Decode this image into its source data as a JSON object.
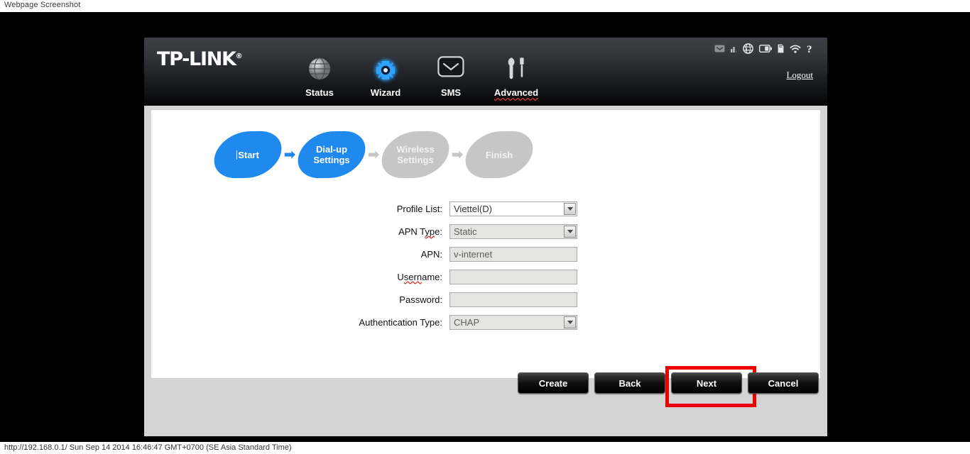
{
  "browser": {
    "top_label": "Webpage Screenshot",
    "status_footer": "http://192.168.0.1/ Sun Sep 14 2014 16:46:47 GMT+0700 (SE Asia Standard Time)"
  },
  "colors": {
    "accent_blue": "#2089ee",
    "inactive_gray": "#c6c6c6",
    "highlight_red": "#ee0000",
    "page_gray": "#d4d4d4"
  },
  "header": {
    "logo": "TP-LINK",
    "logo_mark": "®",
    "logout_label": "Logout",
    "nav": [
      {
        "label": "Status",
        "icon": "globe-icon",
        "active": false,
        "squiggly": false
      },
      {
        "label": "Wizard",
        "icon": "wizard-gear-icon",
        "active": true,
        "squiggly": false
      },
      {
        "label": "SMS",
        "icon": "envelope-icon",
        "active": false,
        "squiggly": false
      },
      {
        "label": "Advanced",
        "icon": "tools-icon",
        "active": false,
        "squiggly": true
      }
    ],
    "status_icons": [
      "message-envelope-icon",
      "signal-bars-icon",
      "globe-roaming-icon",
      "battery-icon",
      "sim-card-icon",
      "wifi-icon",
      "help-question-icon"
    ]
  },
  "wizard": {
    "steps": [
      {
        "label": "Start",
        "state": "active",
        "has_caret": true
      },
      {
        "label": "Dial-up\nSettings",
        "state": "active",
        "has_caret": false
      },
      {
        "label": "Wireless\nSettings",
        "state": "idle",
        "has_caret": false
      },
      {
        "label": "Finish",
        "state": "idle",
        "has_caret": false
      }
    ],
    "arrow_glyph": "➡"
  },
  "form": {
    "fields": [
      {
        "label": "Profile List:",
        "value": "Viettel(D)",
        "type": "select",
        "disabled": false
      },
      {
        "label": "APN Type:",
        "value": "Static",
        "type": "select",
        "disabled": true,
        "squiggly_part": "yp"
      },
      {
        "label": "APN:",
        "value": "v-internet",
        "type": "text",
        "disabled": true
      },
      {
        "label": "Username:",
        "value": "",
        "type": "text",
        "disabled": true,
        "squiggly_part": "sern"
      },
      {
        "label": "Password:",
        "value": "",
        "type": "text",
        "disabled": true
      },
      {
        "label": "Authentication Type:",
        "value": "CHAP",
        "type": "select",
        "disabled": true
      }
    ]
  },
  "buttons": [
    {
      "label": "Create",
      "highlighted": false
    },
    {
      "label": "Back",
      "highlighted": false
    },
    {
      "label": "Next",
      "highlighted": true
    },
    {
      "label": "Cancel",
      "highlighted": false
    }
  ]
}
